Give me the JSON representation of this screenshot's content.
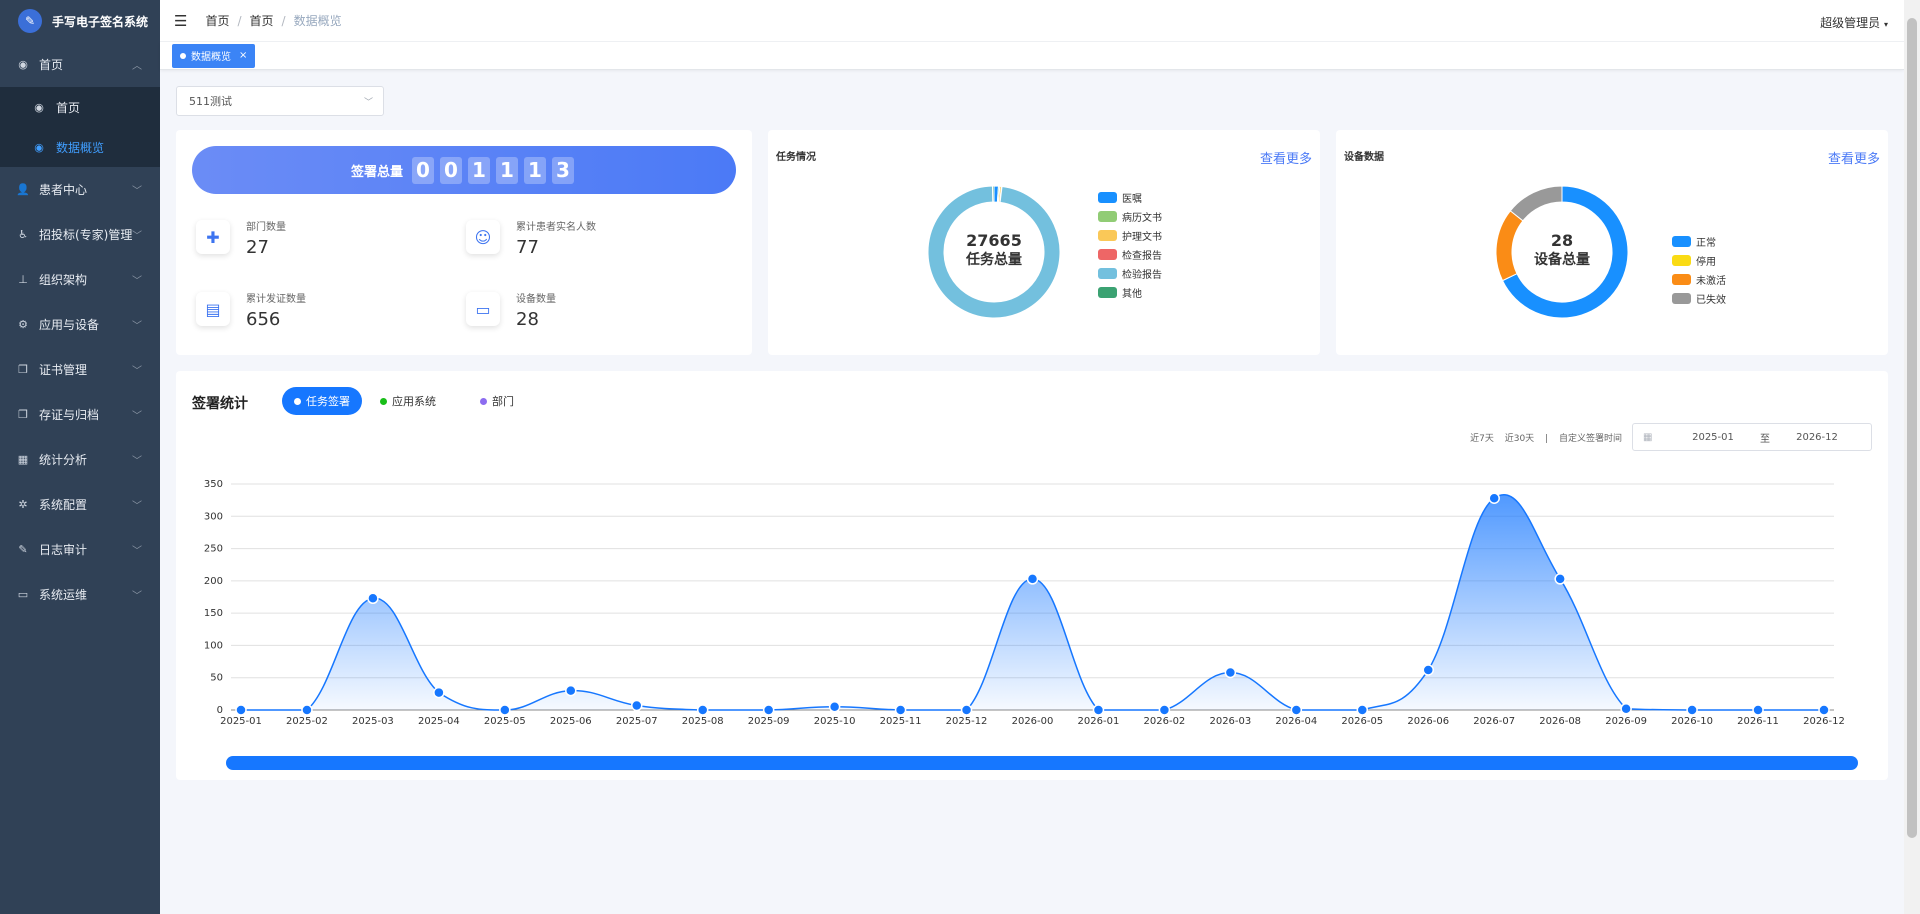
{
  "brand": {
    "title": "手写电子签名系统"
  },
  "sidebar": {
    "home": "首页",
    "home_sub": [
      "首页",
      "数据概览"
    ],
    "items": [
      "患者中心",
      "招投标(专家)管理",
      "组织架构",
      "应用与设备",
      "证书管理",
      "存证与归档",
      "统计分析",
      "系统配置",
      "日志审计",
      "系统运维"
    ]
  },
  "header": {
    "breadcrumb": [
      "首页",
      "首页",
      "数据概览"
    ],
    "user": "超级管理员"
  },
  "tabs": [
    {
      "label": "数据概览"
    }
  ],
  "filter": {
    "selected": "511测试"
  },
  "summary": {
    "label": "签署总量",
    "digits": [
      "0",
      "0",
      "1",
      "1",
      "1",
      "3"
    ],
    "stats": [
      {
        "title": "部门数量",
        "value": "27"
      },
      {
        "title": "累计患者实名人数",
        "value": "77"
      },
      {
        "title": "累计发证数量",
        "value": "656"
      },
      {
        "title": "设备数量",
        "value": "28"
      }
    ]
  },
  "task_card": {
    "title": "任务情况",
    "more": "查看更多",
    "center_value": "27665",
    "center_label": "任务总量"
  },
  "device_card": {
    "title": "设备数据",
    "more": "查看更多",
    "center_value": "28",
    "center_label": "设备总量"
  },
  "sign_stats": {
    "title": "签署统计",
    "tabs": [
      "任务签署",
      "应用系统",
      "部门"
    ],
    "tab_colors": [
      "#1677ff",
      "#19be19",
      "#8c6cf0"
    ],
    "quick": [
      "近7天",
      "近30天",
      "|",
      "自定义签署时间"
    ],
    "date_from": "2025-01",
    "date_sep": "至",
    "date_to": "2026-12"
  },
  "chart_data": [
    {
      "type": "pie",
      "title": "任务情况",
      "labels": [
        "医嘱",
        "病历文书",
        "护理文书",
        "检查报告",
        "检验报告",
        "其他"
      ],
      "values": [
        300,
        90,
        120,
        30,
        27025,
        100
      ],
      "colors": [
        "#1890ff",
        "#91cc75",
        "#fac858",
        "#ee6666",
        "#73c0de",
        "#3ba272"
      ]
    },
    {
      "type": "pie",
      "title": "设备数据",
      "labels": [
        "正常",
        "停用",
        "未激活",
        "已失效"
      ],
      "values": [
        19,
        0,
        5,
        4
      ],
      "colors": [
        "#1890ff",
        "#fadb14",
        "#fa8c16",
        "#999999"
      ]
    },
    {
      "type": "area",
      "title": "签署统计",
      "x": [
        "2025-01",
        "2025-02",
        "2025-03",
        "2025-04",
        "2025-05",
        "2025-06",
        "2025-07",
        "2025-08",
        "2025-09",
        "2025-10",
        "2025-11",
        "2025-12",
        "2026-00",
        "2026-01",
        "2026-02",
        "2026-03",
        "2026-04",
        "2026-05",
        "2026-06",
        "2026-07",
        "2026-08",
        "2026-09",
        "2026-10",
        "2026-11",
        "2026-12"
      ],
      "values": [
        0,
        0,
        173,
        27,
        0,
        30,
        7,
        0,
        0,
        5,
        0,
        0,
        203,
        0,
        0,
        58,
        0,
        0,
        62,
        328,
        203,
        2,
        0,
        0,
        0
      ],
      "yticks": [
        0,
        50,
        100,
        150,
        200,
        250,
        300,
        350
      ],
      "ylim": [
        0,
        350
      ],
      "grid": true,
      "color": "#1677ff"
    }
  ]
}
